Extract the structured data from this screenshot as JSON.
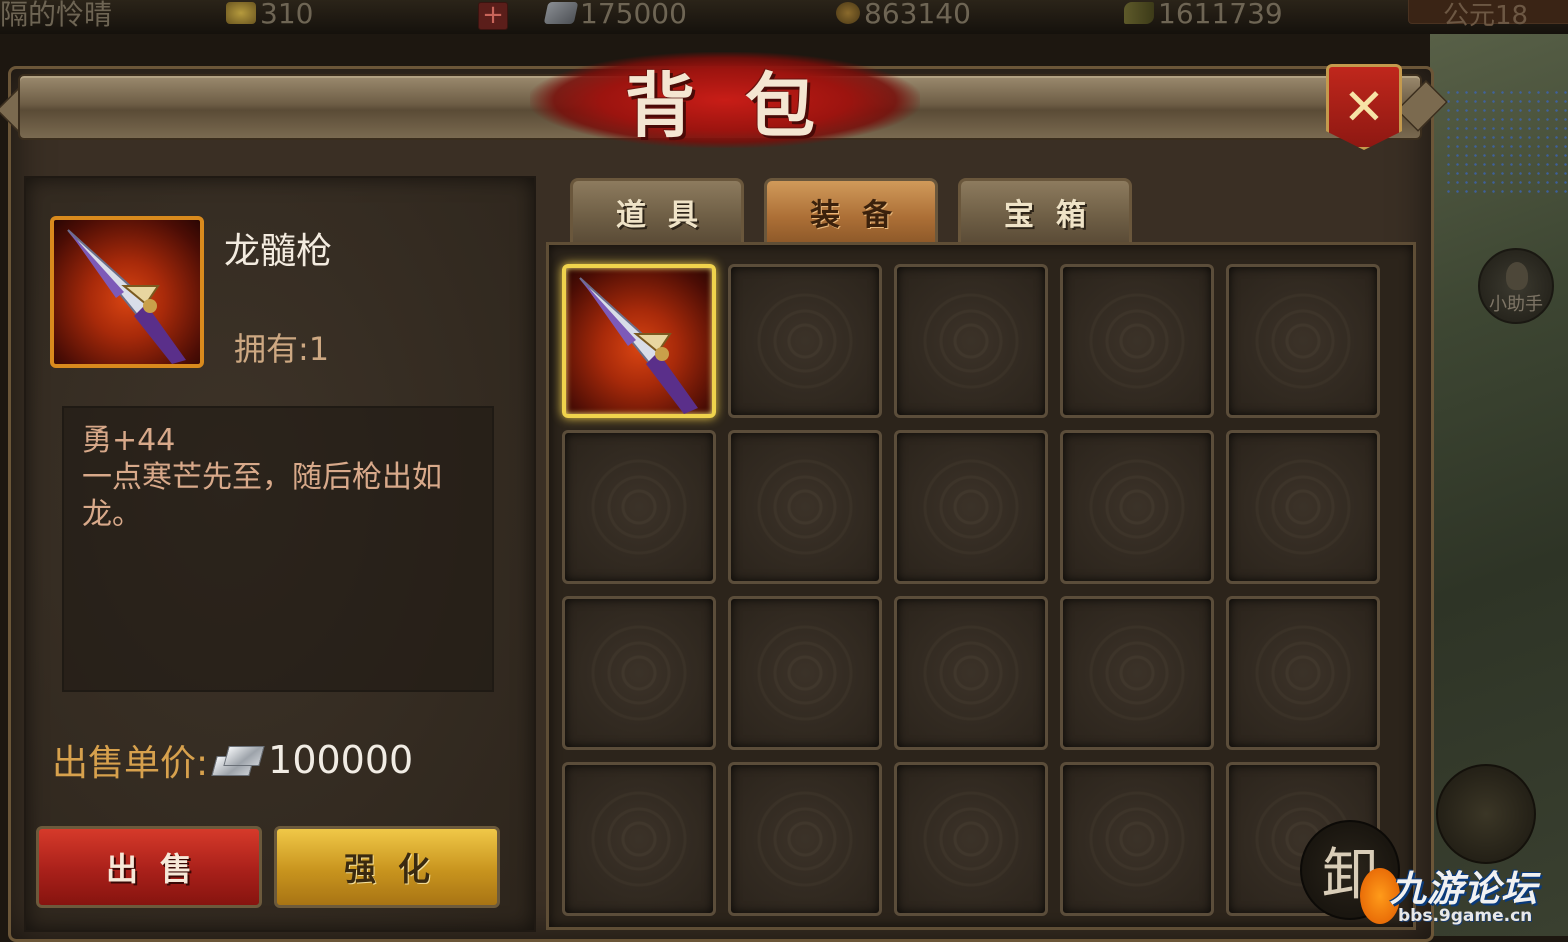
{
  "topbar": {
    "player_name": "隔的怜晴",
    "gold": "310",
    "silver": "175000",
    "copper": "863140",
    "grain": "1611739",
    "era": "公元18"
  },
  "dialog": {
    "title": "背包",
    "close_icon": "close-x-icon"
  },
  "tabs": [
    {
      "label": "道具",
      "active": false
    },
    {
      "label": "装备",
      "active": true
    },
    {
      "label": "宝箱",
      "active": false
    }
  ],
  "item": {
    "name": "龙髓枪",
    "owned": "拥有:1",
    "description": "勇+44\n一点寒芒先至，随后枪出如龙。",
    "price_label": "出售单价:",
    "price_value": "100000",
    "icon": "dragon-spear-icon"
  },
  "actions": {
    "sell": "出售",
    "enhance": "强化"
  },
  "grid": {
    "rows": 4,
    "cols": 5,
    "selected_index": 0,
    "filled": [
      0
    ]
  },
  "side": {
    "helper_label": "小助手",
    "unload_label": "卸"
  },
  "watermark": {
    "title": "九游论坛",
    "url": "bbs.9game.cn"
  },
  "colors": {
    "accent_red": "#c81d17",
    "gold_border": "#f0d34c",
    "price_label": "#d7a14d"
  }
}
